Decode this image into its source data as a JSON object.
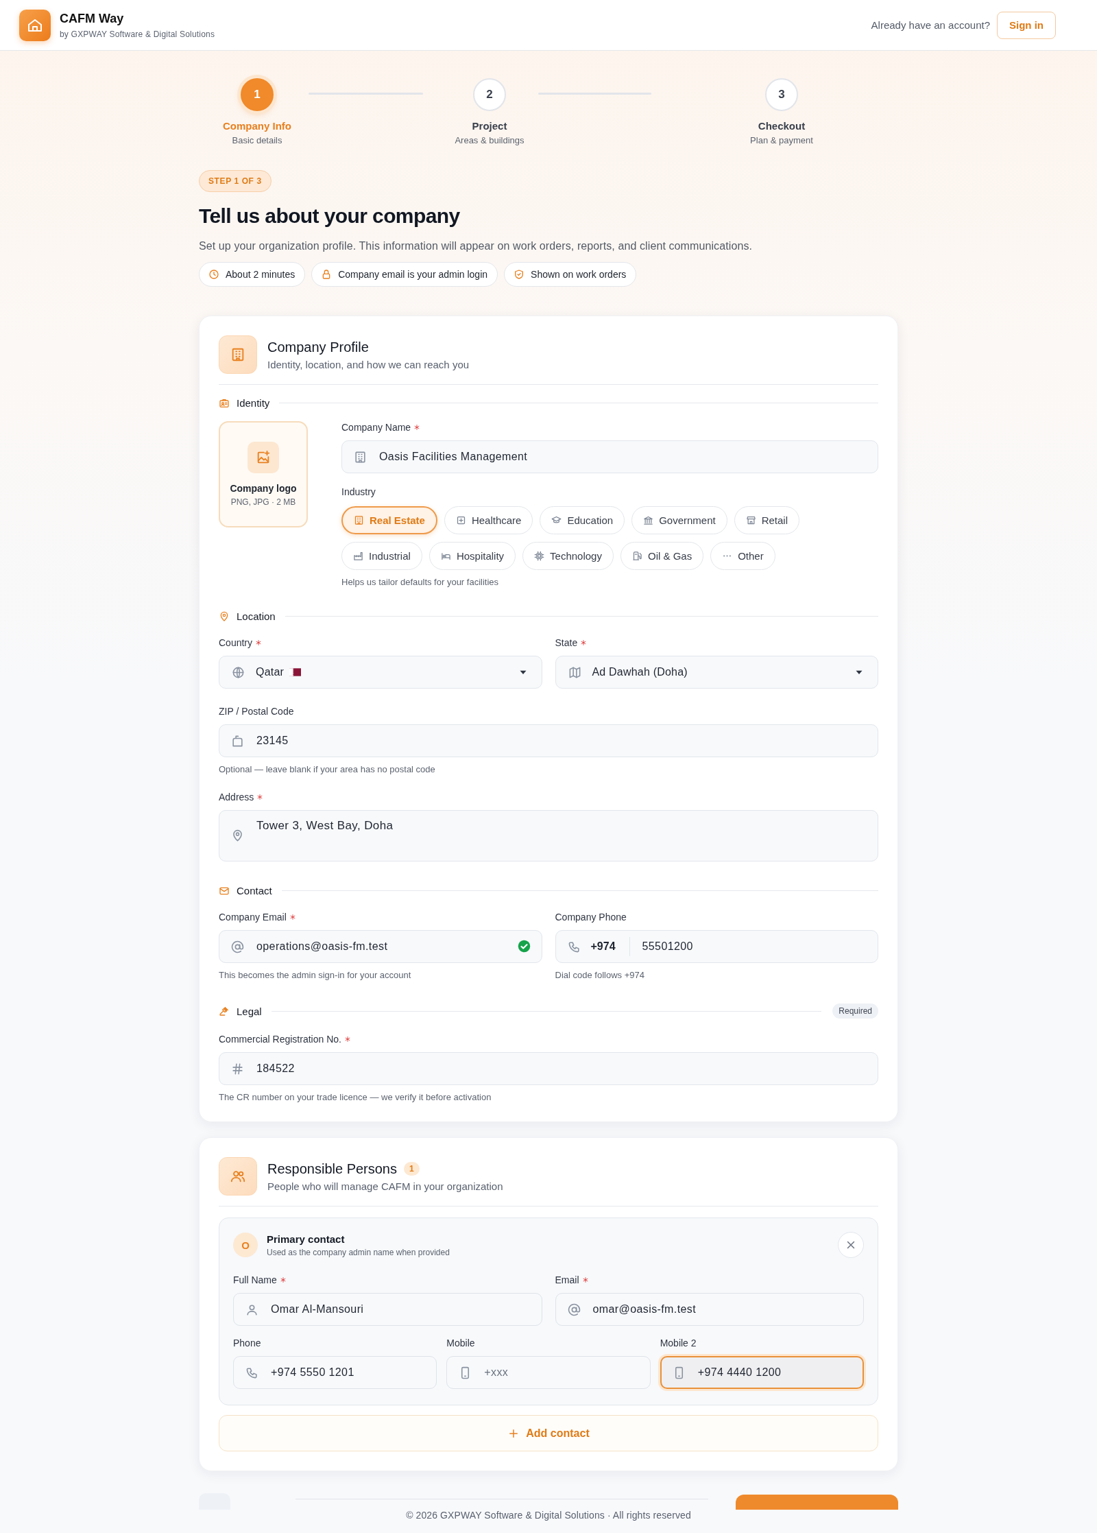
{
  "header": {
    "app_name": "CAFM Way",
    "tagline": "by GXPWAY Software & Digital Solutions",
    "account_prompt": "Already have an account?",
    "sign_in": "Sign in"
  },
  "stepper": {
    "steps": [
      {
        "number": "1",
        "label": "Company Info",
        "sublabel": "Basic details",
        "selected": true
      },
      {
        "number": "2",
        "label": "Project",
        "sublabel": "Areas & buildings",
        "selected": false
      },
      {
        "number": "3",
        "label": "Checkout",
        "sublabel": "Plan & payment",
        "selected": false
      }
    ]
  },
  "intro": {
    "badge": "STEP 1 OF 3",
    "title": "Tell us about your company",
    "description": "Set up your organization profile. This information will appear on work orders, reports, and client communications.",
    "chips": [
      {
        "label": "About 2 minutes"
      },
      {
        "label": "Company email is your admin login"
      },
      {
        "label": "Shown on work orders"
      }
    ]
  },
  "company_profile": {
    "title": "Company Profile",
    "subtitle": "Identity, location, and how we can reach you",
    "identity": {
      "heading": "Identity",
      "logo_upload": {
        "label": "Company logo",
        "hint": "PNG, JPG · 2 MB"
      },
      "company_name": {
        "label": "Company Name",
        "required": true,
        "value": "Oasis Facilities Management"
      },
      "industry": {
        "label": "Industry",
        "hint": "Helps us tailor defaults for your facilities",
        "options": [
          {
            "label": "Real Estate",
            "selected": true
          },
          {
            "label": "Healthcare",
            "selected": false
          },
          {
            "label": "Education",
            "selected": false
          },
          {
            "label": "Government",
            "selected": false
          },
          {
            "label": "Retail",
            "selected": false
          },
          {
            "label": "Industrial",
            "selected": false
          },
          {
            "label": "Hospitality",
            "selected": false
          },
          {
            "label": "Technology",
            "selected": false
          },
          {
            "label": "Oil & Gas",
            "selected": false
          },
          {
            "label": "Other",
            "selected": false
          }
        ]
      }
    },
    "location": {
      "heading": "Location",
      "fields": [
        {
          "kind": "select",
          "label": "Country",
          "required": true,
          "value": "Qatar"
        },
        {
          "kind": "select",
          "label": "State",
          "required": true,
          "value": "Ad Dawhah (Doha)"
        },
        {
          "kind": "text",
          "label": "ZIP / Postal Code",
          "required": false,
          "value": "23145",
          "hint": "Optional — leave blank if your area has no postal code"
        },
        {
          "kind": "textarea",
          "label": "Address",
          "required": true,
          "value": "Tower 3, West Bay, Doha"
        }
      ]
    },
    "contact": {
      "heading": "Contact",
      "fields": [
        {
          "kind": "text",
          "label": "Company Email",
          "required": true,
          "value": "operations@oasis-fm.test",
          "verified": true,
          "hint": "This becomes the admin sign-in for your account"
        },
        {
          "kind": "phone",
          "label": "Company Phone",
          "required": false,
          "dial_code": "+974",
          "value": "55501200",
          "hint": "Dial code follows +974"
        }
      ]
    },
    "legal": {
      "heading": "Legal",
      "badge": "Required",
      "fields": [
        {
          "label": "Commercial Registration No.",
          "required": true,
          "value": "184522",
          "hint": "The CR number on your trade licence — we verify it before activation"
        }
      ]
    }
  },
  "responsible_persons": {
    "title": "Responsible Persons",
    "count": "1",
    "subtitle": "People who will manage CAFM in your organization",
    "contacts": [
      {
        "initial": "O",
        "title": "Primary contact",
        "subtitle": "Used as the company admin name when provided",
        "fields": [
          {
            "label": "Full Name",
            "required": true,
            "value": "Omar Al-Mansouri",
            "focused": false
          },
          {
            "label": "Email",
            "required": true,
            "value": "omar@oasis-fm.test",
            "focused": false
          },
          {
            "label": "Phone",
            "required": false,
            "value": "+974 5550 1201",
            "focused": false
          },
          {
            "label": "Mobile",
            "required": false,
            "placeholder": "+xxx",
            "focused": false
          },
          {
            "label": "Mobile 2",
            "required": false,
            "value": "+974 4440 1200",
            "focused": true
          }
        ]
      }
    ],
    "add_button": "Add contact"
  },
  "footer": {
    "copyright": "© 2026 GXPWAY Software & Digital Solutions · All rights reserved"
  }
}
